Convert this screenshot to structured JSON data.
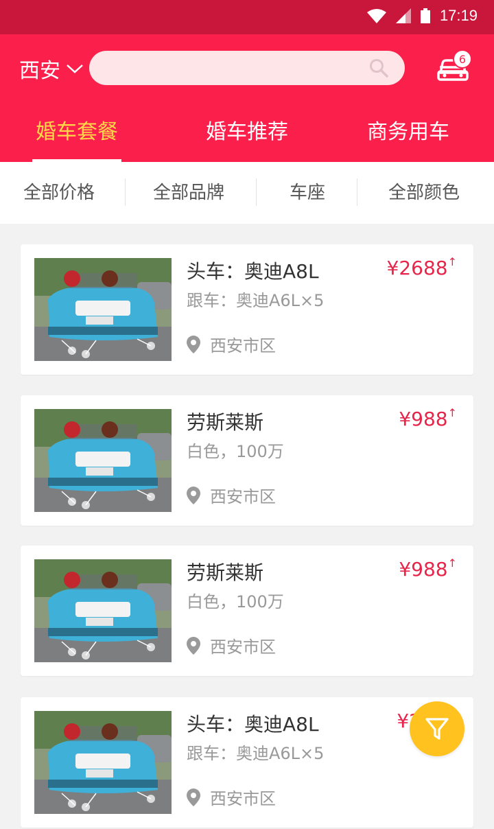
{
  "status_bar": {
    "time": "17:19"
  },
  "header": {
    "city": "西安",
    "search_placeholder": "",
    "cart_count": "6"
  },
  "tabs": [
    {
      "label": "婚车套餐",
      "active": true
    },
    {
      "label": "婚车推荐",
      "active": false
    },
    {
      "label": "商务用车",
      "active": false
    }
  ],
  "filters": [
    {
      "label": "全部价格"
    },
    {
      "label": "全部品牌"
    },
    {
      "label": "车座"
    },
    {
      "label": "全部颜色"
    }
  ],
  "listings": [
    {
      "title": "头车：奥迪A8L",
      "subtitle": "跟车：奥迪A6L×5",
      "price": "¥2688",
      "location": "西安市区"
    },
    {
      "title": "劳斯莱斯",
      "subtitle": "白色，100万",
      "price": "¥988",
      "location": "西安市区"
    },
    {
      "title": "劳斯莱斯",
      "subtitle": "白色，100万",
      "price": "¥988",
      "location": "西安市区"
    },
    {
      "title": "头车：奥迪A8L",
      "subtitle": "跟车：奥迪A6L×5",
      "price": "¥2",
      "location": "西安市区"
    }
  ],
  "colors": {
    "brand": "#fb1f4c",
    "status_bar": "#c8173a",
    "active_tab": "#ffd84a",
    "price": "#e7254a",
    "fab": "#ffc21f"
  }
}
